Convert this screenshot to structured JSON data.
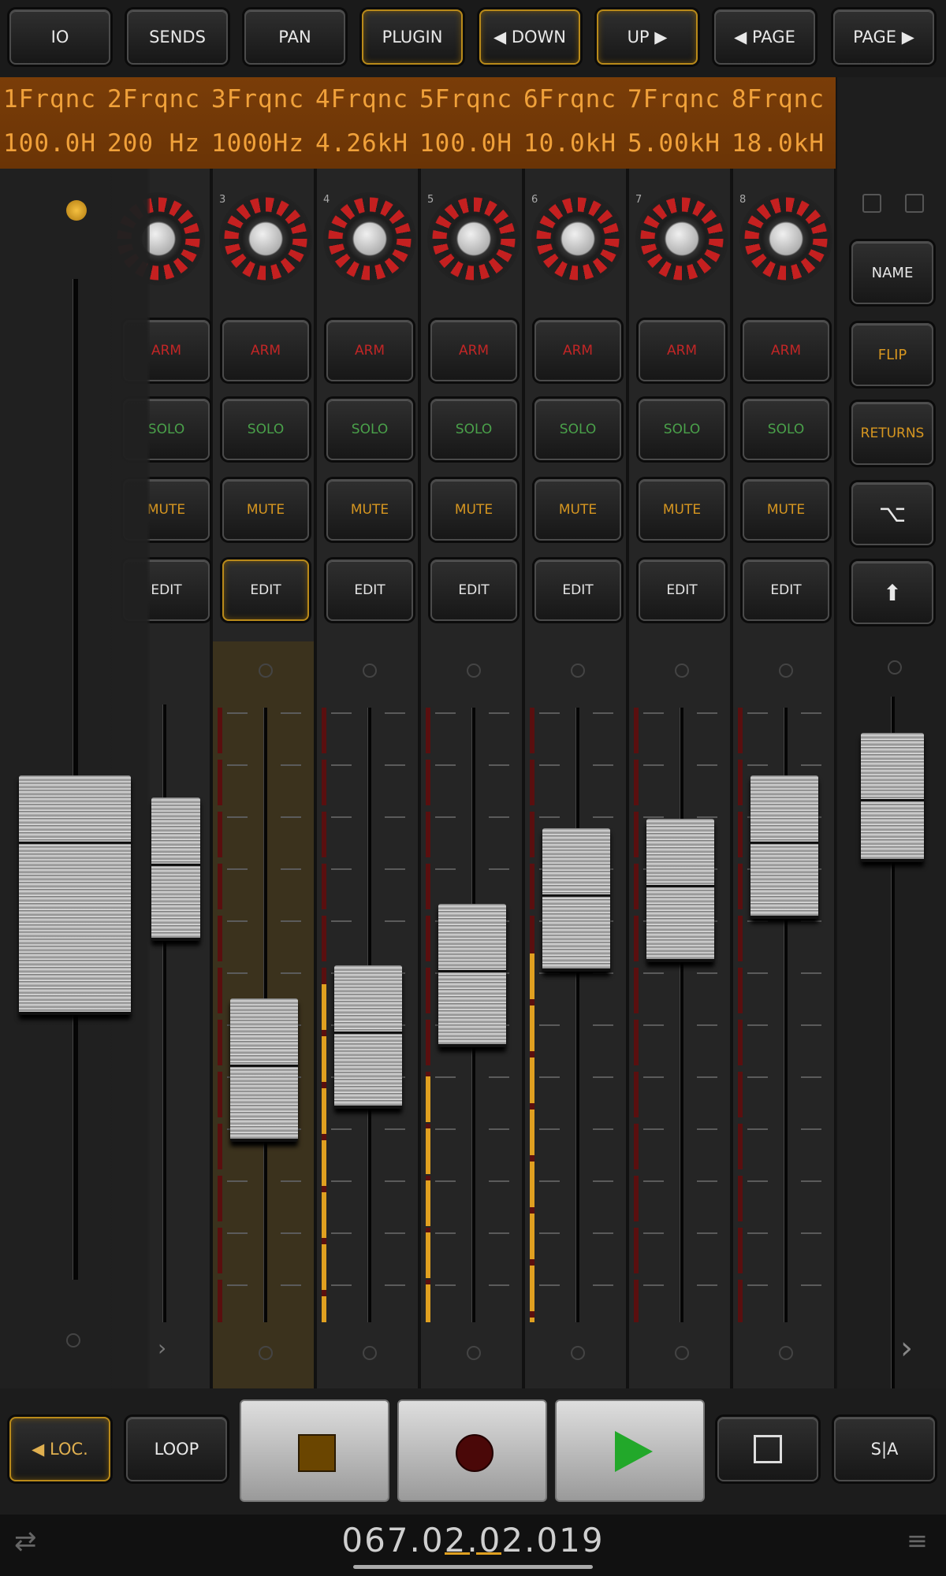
{
  "top_buttons": [
    "IO",
    "SENDS",
    "PAN",
    "PLUGIN",
    "◀ DOWN",
    "UP ▶",
    "◀ PAGE",
    "PAGE ▶"
  ],
  "lcd": {
    "names": [
      "1Frqnc",
      "2Frqnc",
      "3Frqnc",
      "4Frqnc",
      "5Frqnc",
      "6Frqnc",
      "7Frqnc",
      "8Frqnc"
    ],
    "values": [
      "100.0H",
      "200 Hz",
      "1000Hz",
      "4.26kH",
      "100.0H",
      "10.0kH",
      "5.00kH",
      "18.0kH"
    ]
  },
  "bank_number": "3",
  "strips": [
    {
      "num": "3",
      "arm": "ARM",
      "solo": "SOLO",
      "mute": "MUTE",
      "edit": "EDIT",
      "fader_level": 0.32
    },
    {
      "num": "4",
      "arm": "ARM",
      "solo": "SOLO",
      "mute": "MUTE",
      "edit": "EDIT",
      "fader_level": 0.39
    },
    {
      "num": "5",
      "arm": "ARM",
      "solo": "SOLO",
      "mute": "MUTE",
      "edit": "EDIT",
      "fader_level": 0.52
    },
    {
      "num": "6",
      "arm": "ARM",
      "solo": "SOLO",
      "mute": "MUTE",
      "edit": "EDIT",
      "fader_level": 0.68
    },
    {
      "num": "7",
      "arm": "ARM",
      "solo": "SOLO",
      "mute": "MUTE",
      "edit": "EDIT",
      "fader_level": 0.7
    },
    {
      "num": "8",
      "arm": "ARM",
      "solo": "SOLO",
      "mute": "MUTE",
      "edit": "EDIT",
      "fader_level": 0.79
    }
  ],
  "partial_strip": {
    "arm": "ARM",
    "solo": "SOLO",
    "mute": "MUTE",
    "edit": "EDIT"
  },
  "right_buttons": {
    "name": "NAME",
    "flip": "FLIP",
    "returns": "RETURNS"
  },
  "transport": {
    "loc": "◀ LOC.",
    "loop": "LOOP",
    "sa": "S|A"
  },
  "counter": "067.02.02.019",
  "colors": {
    "accent": "#b98a1a",
    "lcd_text": "#f0a13a",
    "arm": "#c22626",
    "solo": "#4aa14a",
    "mute": "#d69620",
    "play": "#22a82a"
  }
}
